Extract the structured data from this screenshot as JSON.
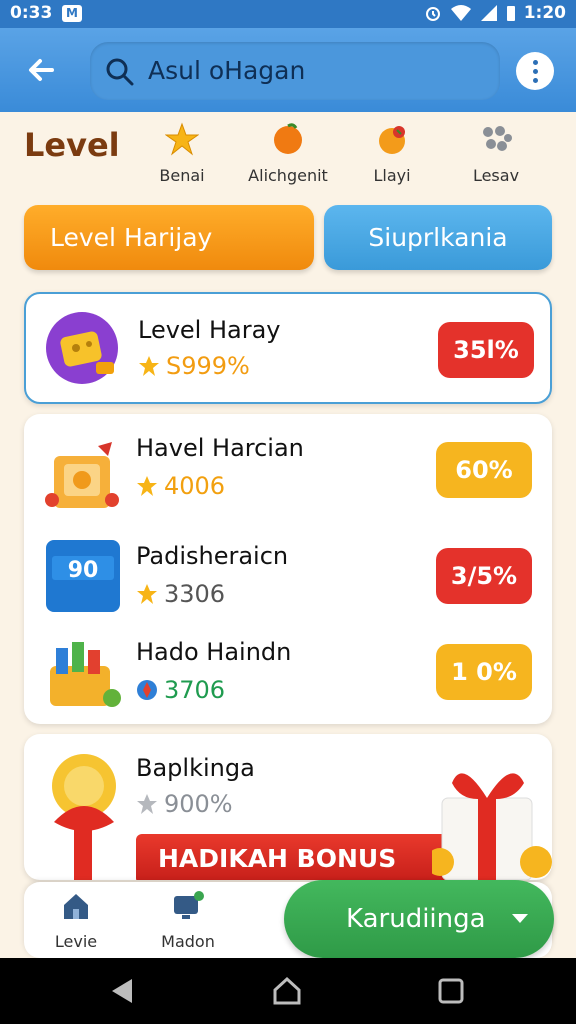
{
  "status_bar": {
    "time": "0:33",
    "notif_icon": "M",
    "clock": "1:20"
  },
  "search": {
    "query": "Asul oHagan"
  },
  "level": {
    "title": "Level",
    "categories": [
      {
        "label": "Benai",
        "icon": "star-icon"
      },
      {
        "label": "Alichgenit",
        "icon": "orange-fruit-icon"
      },
      {
        "label": "Llayi",
        "icon": "apple-icon"
      },
      {
        "label": "Lesav",
        "icon": "dots-cluster-icon"
      }
    ]
  },
  "tabs": {
    "primary": "Level Harijay",
    "secondary": "Siuprlkania"
  },
  "cards": {
    "first": {
      "name": "Level Haray",
      "value": "S999%",
      "percent": "35l%"
    },
    "group": [
      {
        "name": "Havel Harcian",
        "value": "4006",
        "percent": "60%"
      },
      {
        "name": "Padisheraicn",
        "value": "3306",
        "percent": "3/5%"
      },
      {
        "name": "Hado Haindn",
        "value": "3706",
        "percent": "1 0%"
      }
    ],
    "bonus": {
      "name": "Baplkinga",
      "value": "900%",
      "banner": "HADIKAH BONUS"
    }
  },
  "bottom_nav": {
    "items": [
      {
        "label": "Levie"
      },
      {
        "label": "Madon"
      }
    ],
    "cta": "Karudiinga"
  },
  "colors": {
    "appbar": "#3a8bd8",
    "orange": "#f08a0d",
    "blue": "#3a9ad9",
    "red": "#e4322b",
    "yellow": "#f6b51f",
    "green": "#2f9a47"
  }
}
